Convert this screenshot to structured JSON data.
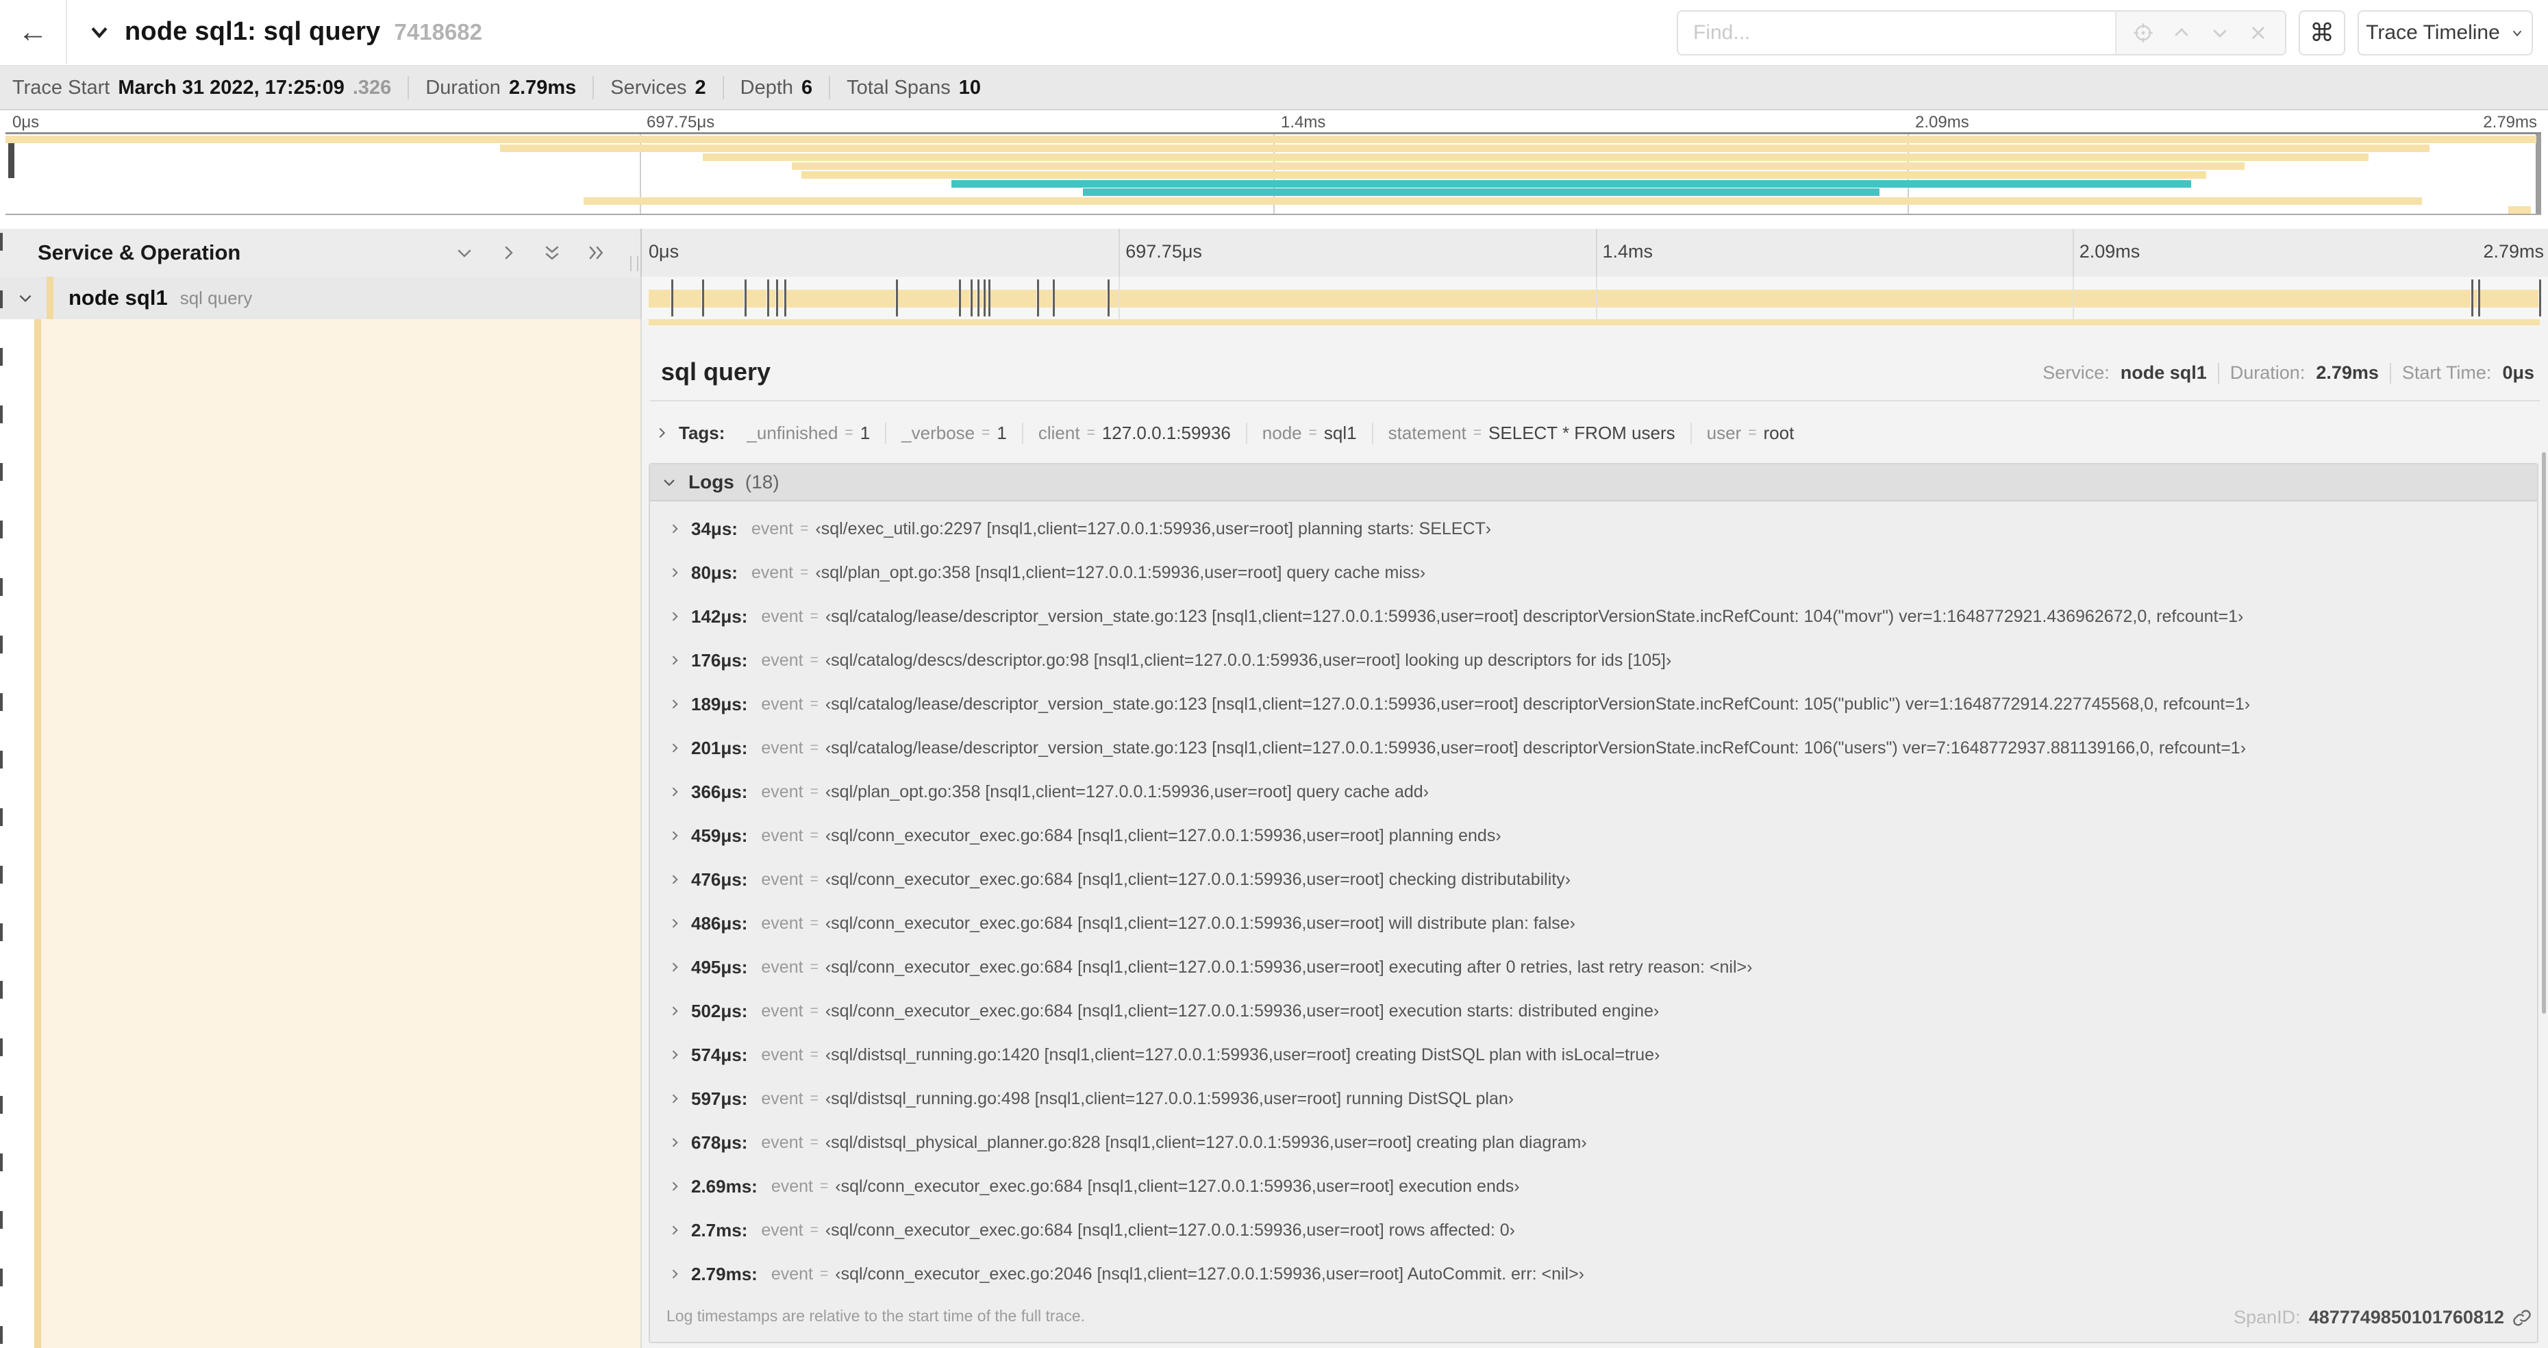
{
  "header": {
    "back_glyph": "←",
    "title": "node sql1: sql query",
    "trace_id": "7418682",
    "find_placeholder": "Find...",
    "command_glyph": "⌘",
    "view_selector_label": "Trace Timeline"
  },
  "summary": {
    "trace_start_label": "Trace Start",
    "trace_start_value": "March 31 2022, 17:25:09",
    "trace_start_fraction": ".326",
    "duration_label": "Duration",
    "duration_value": "2.79ms",
    "services_label": "Services",
    "services_value": "2",
    "depth_label": "Depth",
    "depth_value": "6",
    "total_spans_label": "Total Spans",
    "total_spans_value": "10"
  },
  "timeline": {
    "ticks": [
      "0μs",
      "697.75μs",
      "1.4ms",
      "2.09ms",
      "2.79ms"
    ],
    "columns_header": "Service & Operation",
    "row": {
      "service": "node sql1",
      "operation": "sql query"
    },
    "total_us": 2790,
    "log_marker_us": [
      34,
      80,
      142,
      176,
      189,
      201,
      366,
      459,
      476,
      486,
      495,
      502,
      574,
      597,
      678,
      2690,
      2700,
      2790
    ],
    "minimap_spans": [
      {
        "color": "tan",
        "row": 0,
        "start": 0.0,
        "end": 0.998
      },
      {
        "color": "tan",
        "row": 1,
        "start": 0.195,
        "end": 0.956
      },
      {
        "color": "tan",
        "row": 2,
        "start": 0.275,
        "end": 0.932
      },
      {
        "color": "tan",
        "row": 3,
        "start": 0.31,
        "end": 0.883
      },
      {
        "color": "tan",
        "row": 4,
        "start": 0.314,
        "end": 0.868
      },
      {
        "color": "teal",
        "row": 5,
        "start": 0.373,
        "end": 0.862
      },
      {
        "color": "teal",
        "row": 6,
        "start": 0.425,
        "end": 0.739
      },
      {
        "color": "tan",
        "row": 7,
        "start": 0.228,
        "end": 0.953
      },
      {
        "color": "tan",
        "row": 8,
        "start": 0.987,
        "end": 0.996
      }
    ]
  },
  "detail": {
    "title": "sql query",
    "service_label": "Service:",
    "service_value": "node sql1",
    "duration_label": "Duration:",
    "duration_value": "2.79ms",
    "start_time_label": "Start Time:",
    "start_time_value": "0μs",
    "tags_label": "Tags:",
    "eq": "=",
    "tags": [
      {
        "key": "_unfinished",
        "value": "1"
      },
      {
        "key": "_verbose",
        "value": "1"
      },
      {
        "key": "client",
        "value": "127.0.0.1:59936"
      },
      {
        "key": "node",
        "value": "sql1"
      },
      {
        "key": "statement",
        "value": "SELECT * FROM users"
      },
      {
        "key": "user",
        "value": "root"
      }
    ],
    "logs_label": "Logs",
    "logs_count": "(18)",
    "logs": [
      {
        "time": "34μs:",
        "key": "event",
        "value": "‹sql/exec_util.go:2297 [nsql1,client=127.0.0.1:59936,user=root] planning starts: SELECT›"
      },
      {
        "time": "80μs:",
        "key": "event",
        "value": "‹sql/plan_opt.go:358 [nsql1,client=127.0.0.1:59936,user=root] query cache miss›"
      },
      {
        "time": "142μs:",
        "key": "event",
        "value": "‹sql/catalog/lease/descriptor_version_state.go:123 [nsql1,client=127.0.0.1:59936,user=root] descriptorVersionState.incRefCount: 104(\"movr\") ver=1:1648772921.436962672,0, refcount=1›"
      },
      {
        "time": "176μs:",
        "key": "event",
        "value": "‹sql/catalog/descs/descriptor.go:98 [nsql1,client=127.0.0.1:59936,user=root] looking up descriptors for ids [105]›"
      },
      {
        "time": "189μs:",
        "key": "event",
        "value": "‹sql/catalog/lease/descriptor_version_state.go:123 [nsql1,client=127.0.0.1:59936,user=root] descriptorVersionState.incRefCount: 105(\"public\") ver=1:1648772914.227745568,0, refcount=1›"
      },
      {
        "time": "201μs:",
        "key": "event",
        "value": "‹sql/catalog/lease/descriptor_version_state.go:123 [nsql1,client=127.0.0.1:59936,user=root] descriptorVersionState.incRefCount: 106(\"users\") ver=7:1648772937.881139166,0, refcount=1›"
      },
      {
        "time": "366μs:",
        "key": "event",
        "value": "‹sql/plan_opt.go:358 [nsql1,client=127.0.0.1:59936,user=root] query cache add›"
      },
      {
        "time": "459μs:",
        "key": "event",
        "value": "‹sql/conn_executor_exec.go:684 [nsql1,client=127.0.0.1:59936,user=root] planning ends›"
      },
      {
        "time": "476μs:",
        "key": "event",
        "value": "‹sql/conn_executor_exec.go:684 [nsql1,client=127.0.0.1:59936,user=root] checking distributability›"
      },
      {
        "time": "486μs:",
        "key": "event",
        "value": "‹sql/conn_executor_exec.go:684 [nsql1,client=127.0.0.1:59936,user=root] will distribute plan: false›"
      },
      {
        "time": "495μs:",
        "key": "event",
        "value": "‹sql/conn_executor_exec.go:684 [nsql1,client=127.0.0.1:59936,user=root] executing after 0 retries, last retry reason: <nil>›"
      },
      {
        "time": "502μs:",
        "key": "event",
        "value": "‹sql/conn_executor_exec.go:684 [nsql1,client=127.0.0.1:59936,user=root] execution starts: distributed engine›"
      },
      {
        "time": "574μs:",
        "key": "event",
        "value": "‹sql/distsql_running.go:1420 [nsql1,client=127.0.0.1:59936,user=root] creating DistSQL plan with isLocal=true›"
      },
      {
        "time": "597μs:",
        "key": "event",
        "value": "‹sql/distsql_running.go:498 [nsql1,client=127.0.0.1:59936,user=root] running DistSQL plan›"
      },
      {
        "time": "678μs:",
        "key": "event",
        "value": "‹sql/distsql_physical_planner.go:828 [nsql1,client=127.0.0.1:59936,user=root] creating plan diagram›"
      },
      {
        "time": "2.69ms:",
        "key": "event",
        "value": "‹sql/conn_executor_exec.go:684 [nsql1,client=127.0.0.1:59936,user=root] execution ends›"
      },
      {
        "time": "2.7ms:",
        "key": "event",
        "value": "‹sql/conn_executor_exec.go:684 [nsql1,client=127.0.0.1:59936,user=root] rows affected: 0›"
      },
      {
        "time": "2.79ms:",
        "key": "event",
        "value": "‹sql/conn_executor_exec.go:2046 [nsql1,client=127.0.0.1:59936,user=root] AutoCommit. err: <nil>›"
      }
    ],
    "logs_footer": "Log timestamps are relative to the start time of the full trace.",
    "span_id_label": "SpanID:",
    "span_id": "4877749850101760812"
  },
  "colors": {
    "tan": "#F6E1A9",
    "teal": "#43C4C2",
    "cream": "#FDF3E2",
    "band": "#F2D99E"
  }
}
